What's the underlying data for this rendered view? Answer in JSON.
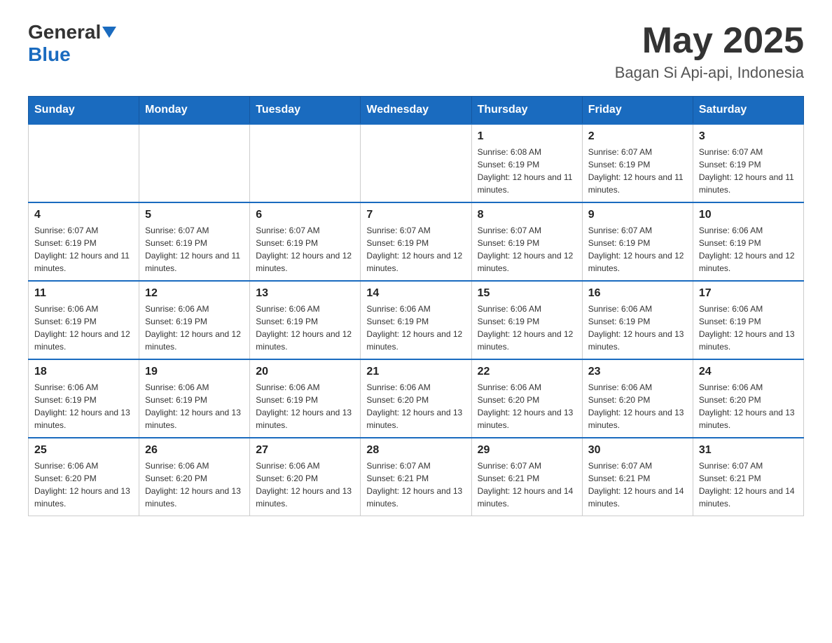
{
  "header": {
    "logo_general": "General",
    "logo_blue": "Blue",
    "month_year": "May 2025",
    "location": "Bagan Si Api-api, Indonesia"
  },
  "days_of_week": [
    "Sunday",
    "Monday",
    "Tuesday",
    "Wednesday",
    "Thursday",
    "Friday",
    "Saturday"
  ],
  "weeks": [
    [
      {
        "day": "",
        "info": ""
      },
      {
        "day": "",
        "info": ""
      },
      {
        "day": "",
        "info": ""
      },
      {
        "day": "",
        "info": ""
      },
      {
        "day": "1",
        "info": "Sunrise: 6:08 AM\nSunset: 6:19 PM\nDaylight: 12 hours and 11 minutes."
      },
      {
        "day": "2",
        "info": "Sunrise: 6:07 AM\nSunset: 6:19 PM\nDaylight: 12 hours and 11 minutes."
      },
      {
        "day": "3",
        "info": "Sunrise: 6:07 AM\nSunset: 6:19 PM\nDaylight: 12 hours and 11 minutes."
      }
    ],
    [
      {
        "day": "4",
        "info": "Sunrise: 6:07 AM\nSunset: 6:19 PM\nDaylight: 12 hours and 11 minutes."
      },
      {
        "day": "5",
        "info": "Sunrise: 6:07 AM\nSunset: 6:19 PM\nDaylight: 12 hours and 11 minutes."
      },
      {
        "day": "6",
        "info": "Sunrise: 6:07 AM\nSunset: 6:19 PM\nDaylight: 12 hours and 12 minutes."
      },
      {
        "day": "7",
        "info": "Sunrise: 6:07 AM\nSunset: 6:19 PM\nDaylight: 12 hours and 12 minutes."
      },
      {
        "day": "8",
        "info": "Sunrise: 6:07 AM\nSunset: 6:19 PM\nDaylight: 12 hours and 12 minutes."
      },
      {
        "day": "9",
        "info": "Sunrise: 6:07 AM\nSunset: 6:19 PM\nDaylight: 12 hours and 12 minutes."
      },
      {
        "day": "10",
        "info": "Sunrise: 6:06 AM\nSunset: 6:19 PM\nDaylight: 12 hours and 12 minutes."
      }
    ],
    [
      {
        "day": "11",
        "info": "Sunrise: 6:06 AM\nSunset: 6:19 PM\nDaylight: 12 hours and 12 minutes."
      },
      {
        "day": "12",
        "info": "Sunrise: 6:06 AM\nSunset: 6:19 PM\nDaylight: 12 hours and 12 minutes."
      },
      {
        "day": "13",
        "info": "Sunrise: 6:06 AM\nSunset: 6:19 PM\nDaylight: 12 hours and 12 minutes."
      },
      {
        "day": "14",
        "info": "Sunrise: 6:06 AM\nSunset: 6:19 PM\nDaylight: 12 hours and 12 minutes."
      },
      {
        "day": "15",
        "info": "Sunrise: 6:06 AM\nSunset: 6:19 PM\nDaylight: 12 hours and 12 minutes."
      },
      {
        "day": "16",
        "info": "Sunrise: 6:06 AM\nSunset: 6:19 PM\nDaylight: 12 hours and 13 minutes."
      },
      {
        "day": "17",
        "info": "Sunrise: 6:06 AM\nSunset: 6:19 PM\nDaylight: 12 hours and 13 minutes."
      }
    ],
    [
      {
        "day": "18",
        "info": "Sunrise: 6:06 AM\nSunset: 6:19 PM\nDaylight: 12 hours and 13 minutes."
      },
      {
        "day": "19",
        "info": "Sunrise: 6:06 AM\nSunset: 6:19 PM\nDaylight: 12 hours and 13 minutes."
      },
      {
        "day": "20",
        "info": "Sunrise: 6:06 AM\nSunset: 6:19 PM\nDaylight: 12 hours and 13 minutes."
      },
      {
        "day": "21",
        "info": "Sunrise: 6:06 AM\nSunset: 6:20 PM\nDaylight: 12 hours and 13 minutes."
      },
      {
        "day": "22",
        "info": "Sunrise: 6:06 AM\nSunset: 6:20 PM\nDaylight: 12 hours and 13 minutes."
      },
      {
        "day": "23",
        "info": "Sunrise: 6:06 AM\nSunset: 6:20 PM\nDaylight: 12 hours and 13 minutes."
      },
      {
        "day": "24",
        "info": "Sunrise: 6:06 AM\nSunset: 6:20 PM\nDaylight: 12 hours and 13 minutes."
      }
    ],
    [
      {
        "day": "25",
        "info": "Sunrise: 6:06 AM\nSunset: 6:20 PM\nDaylight: 12 hours and 13 minutes."
      },
      {
        "day": "26",
        "info": "Sunrise: 6:06 AM\nSunset: 6:20 PM\nDaylight: 12 hours and 13 minutes."
      },
      {
        "day": "27",
        "info": "Sunrise: 6:06 AM\nSunset: 6:20 PM\nDaylight: 12 hours and 13 minutes."
      },
      {
        "day": "28",
        "info": "Sunrise: 6:07 AM\nSunset: 6:21 PM\nDaylight: 12 hours and 13 minutes."
      },
      {
        "day": "29",
        "info": "Sunrise: 6:07 AM\nSunset: 6:21 PM\nDaylight: 12 hours and 14 minutes."
      },
      {
        "day": "30",
        "info": "Sunrise: 6:07 AM\nSunset: 6:21 PM\nDaylight: 12 hours and 14 minutes."
      },
      {
        "day": "31",
        "info": "Sunrise: 6:07 AM\nSunset: 6:21 PM\nDaylight: 12 hours and 14 minutes."
      }
    ]
  ]
}
